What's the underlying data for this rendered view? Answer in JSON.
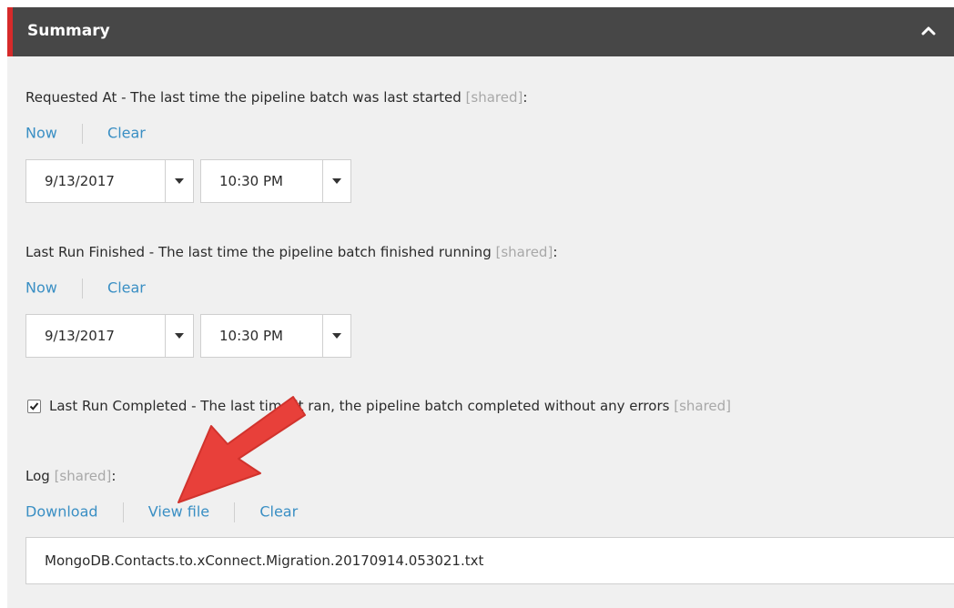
{
  "header": {
    "title": "Summary",
    "toggle_icon": "chevron-up-icon"
  },
  "requested_at": {
    "label": "Requested At - The last time the pipeline batch was last started",
    "shared": "[shared]",
    "colon": ":",
    "now": "Now",
    "clear": "Clear",
    "date": "9/13/2017",
    "time": "10:30 PM"
  },
  "last_run_finished": {
    "label": "Last Run Finished - The last time the pipeline batch finished running",
    "shared": "[shared]",
    "colon": ":",
    "now": "Now",
    "clear": "Clear",
    "date": "9/13/2017",
    "time": "10:30 PM"
  },
  "last_run_completed": {
    "checked": true,
    "label": "Last Run Completed - The last time it ran, the pipeline batch completed without any errors",
    "shared": "[shared]"
  },
  "log": {
    "label": "Log",
    "shared": "[shared]",
    "colon": ":",
    "download": "Download",
    "view_file": "View file",
    "clear": "Clear",
    "value": "MongoDB.Contacts.to.xConnect.Migration.20170914.053021.txt"
  },
  "colors": {
    "header_bg": "#474747",
    "accent_red": "#d62a2a",
    "link_blue": "#3a8fc4",
    "annotation_arrow": "#e8403a"
  }
}
